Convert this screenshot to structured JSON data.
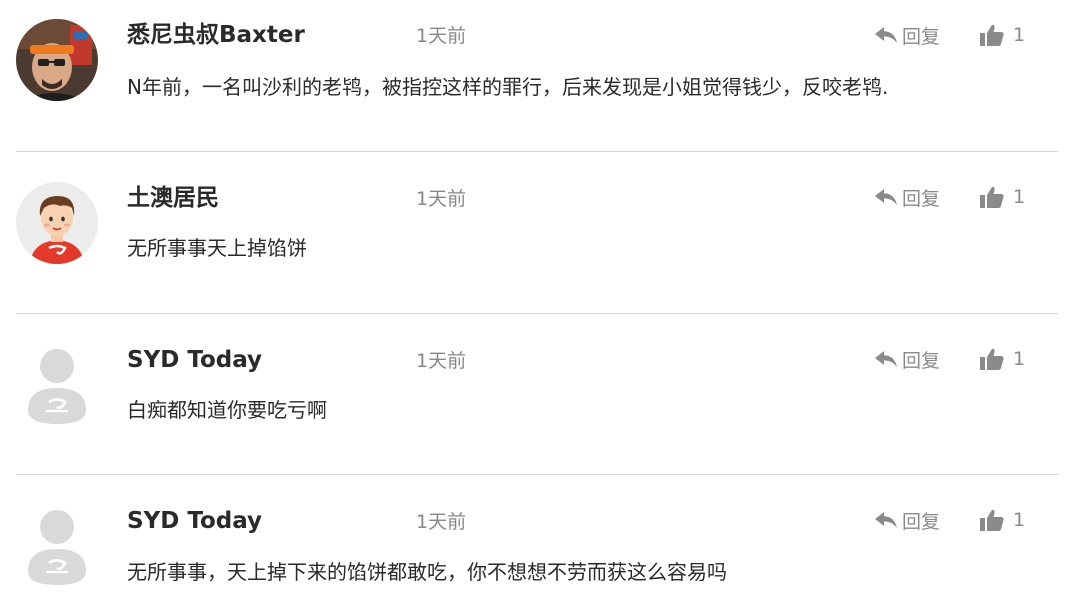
{
  "comments": [
    {
      "author": "悉尼虫叔Baxter",
      "time": "1天前",
      "reply_label": "回复",
      "likes": "1",
      "text": "N年前，一名叫沙利的老鸨，被指控这样的罪行，后来发现是小姐觉得钱少，反咬老鸨.",
      "avatar": "photo-avatar-orange-headband"
    },
    {
      "author": "土澳居民",
      "time": "1天前",
      "reply_label": "回复",
      "likes": "1",
      "text": "无所事事天上掉馅饼",
      "avatar": "cartoon-avatar-red-shirt"
    },
    {
      "author": "SYD Today",
      "time": "1天前",
      "reply_label": "回复",
      "likes": "1",
      "text": "白痴都知道你要吃亏啊",
      "avatar": "default-user-avatar"
    },
    {
      "author": "SYD Today",
      "time": "1天前",
      "reply_label": "回复",
      "likes": "1",
      "text": "无所事事，天上掉下来的馅饼都敢吃，你不想想不劳而获这么容易吗",
      "avatar": "default-user-avatar"
    }
  ],
  "colors": {
    "divider": "#d9d9d9",
    "muted": "#8a8a8a",
    "text": "#2a2a2a",
    "accent": "#e8412c"
  }
}
